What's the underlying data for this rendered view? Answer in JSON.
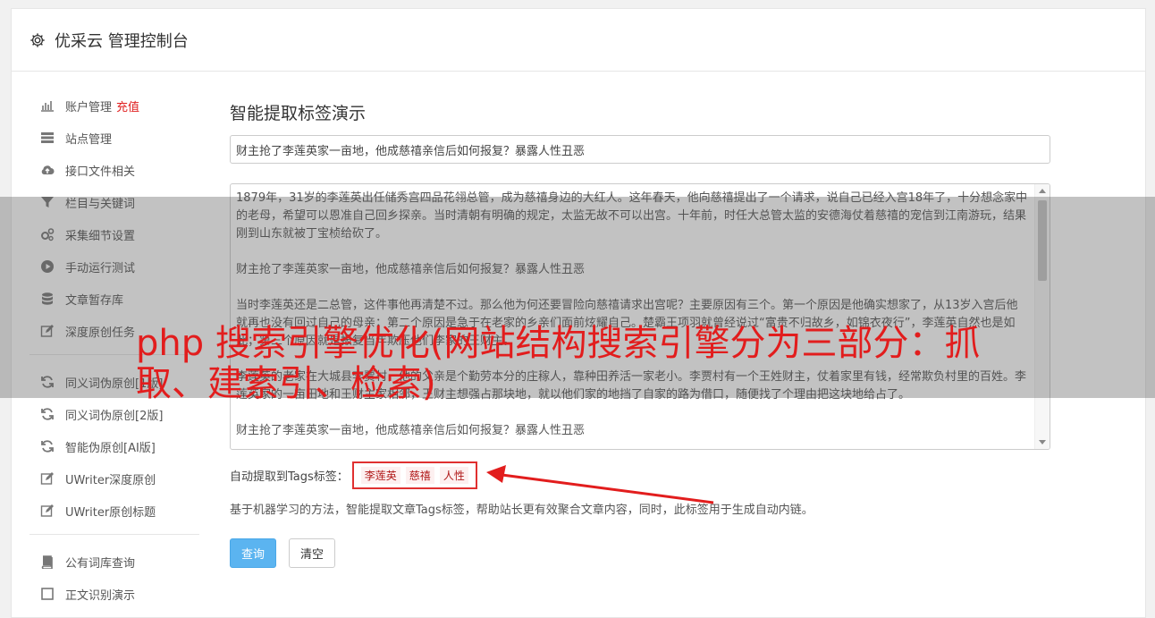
{
  "header": {
    "title": "优采云 管理控制台",
    "icon": "gear-icon"
  },
  "sidebar": {
    "items": [
      {
        "label": "账户管理",
        "extra": "充值",
        "icon": "bar-chart-icon"
      },
      {
        "label": "站点管理",
        "icon": "server-icon"
      },
      {
        "label": "接口文件相关",
        "icon": "cloud-upload-icon"
      },
      {
        "label": "栏目与关键词",
        "icon": "filter-icon"
      },
      {
        "label": "采集细节设置",
        "icon": "cogs-icon"
      },
      {
        "label": "手动运行测试",
        "icon": "play-circle-icon"
      },
      {
        "label": "文章暂存库",
        "icon": "database-icon"
      },
      {
        "label": "深度原创任务",
        "icon": "edit-icon"
      }
    ],
    "items2": [
      {
        "label": "同义词伪原创[1版]",
        "icon": "refresh-icon"
      },
      {
        "label": "同义词伪原创[2版]",
        "icon": "refresh-icon"
      },
      {
        "label": "智能伪原创[AI版]",
        "icon": "refresh-icon"
      },
      {
        "label": "UWriter深度原创",
        "icon": "edit-icon"
      },
      {
        "label": "UWriter原创标题",
        "icon": "edit-icon"
      }
    ],
    "items3": [
      {
        "label": "公有词库查询",
        "icon": "book-icon"
      },
      {
        "label": "正文识别演示",
        "icon": "square-icon"
      }
    ]
  },
  "main": {
    "title": "智能提取标签演示",
    "article_title": "财主抢了李莲英家一亩地，他成慈禧亲信后如何报复？暴露人性丑恶",
    "paragraphs": [
      "1879年，31岁的李莲英出任储秀宫四品花翎总管，成为慈禧身边的大红人。这年春天，他向慈禧提出了一个请求，说自己已经入宫18年了，十分想念家中的老母，希望可以恩准自己回乡探亲。当时清朝有明确的规定，太监无故不可以出宫。十年前，时任大总管太监的安德海仗着慈禧的宠信到江南游玩，结果刚到山东就被丁宝桢给砍了。",
      "财主抢了李莲英家一亩地，他成慈禧亲信后如何报复？暴露人性丑恶",
      "当时李莲英还是二总管，这件事他再清楚不过。那么他为何还要冒险向慈禧请求出宫呢？主要原因有三个。第一个原因是他确实想家了，从13岁入宫后他就再也没有回过自己的母亲；第二个原因是急于在老家的乡亲们面前炫耀自己。楚霸王项羽就曾经说过“富贵不归故乡，如锦衣夜行”，李莲英自然也是如此；第三个原因就是报复当年欺压他们李家的王财主。",
      "李莲英的老家在大城县李贾村，他的父亲是个勤劳本分的庄稼人，靠种田养活一家老小。李贾村有一个王姓财主，仗着家里有钱，经常欺负村里的百姓。李莲英家的一亩田地和王财主家相邻，王财主想强占那块地，就以他们家的地挡了自家的路为借口，随便找了个理由把这块地给占了。",
      "财主抢了李莲英家一亩地，他成慈禧亲信后如何报复？暴露人性丑恶"
    ],
    "tags_label": "自动提取到Tags标签：",
    "tags": [
      "李莲英",
      "慈禧",
      "人性"
    ],
    "description": "基于机器学习的方法，智能提取文章Tags标签，帮助站长更有效聚合文章内容，同时，此标签用于生成自动内链。",
    "query_button": "查询",
    "clear_button": "清空"
  },
  "overlay": {
    "headline": "php 搜索引擎优化(网站结构搜索引擎分为三部分：抓取、建索引、检索)"
  },
  "colors": {
    "accent": "#5bb4f0",
    "highlight_red": "#e21d1d"
  }
}
